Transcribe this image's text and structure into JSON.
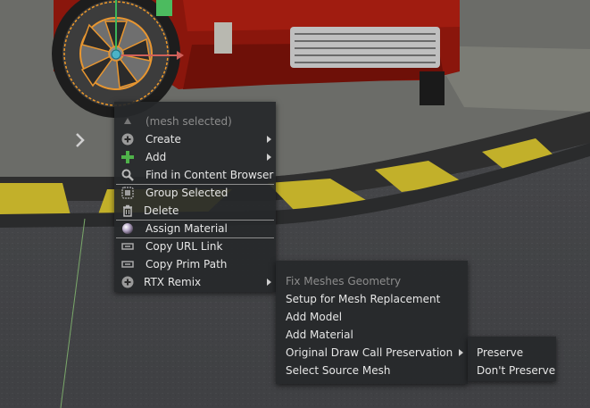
{
  "context_menu": {
    "header": "(mesh selected)",
    "items": [
      {
        "label": "Create",
        "icon": "plus-circle-icon"
      },
      {
        "label": "Add",
        "icon": "plus-icon"
      },
      {
        "label": "Find in Content Browser",
        "icon": "search-icon"
      },
      {
        "label": "Group Selected",
        "icon": "group-icon"
      },
      {
        "label": "Delete",
        "icon": "trash-icon"
      },
      {
        "label": "Assign Material",
        "icon": "material-sphere-icon"
      },
      {
        "label": "Copy URL Link",
        "icon": "link-icon"
      },
      {
        "label": "Copy Prim Path",
        "icon": "link-icon"
      },
      {
        "label": "RTX Remix",
        "icon": "plus-circle-icon"
      }
    ]
  },
  "rtx_submenu": {
    "items": [
      {
        "label": "Fix Meshes Geometry",
        "enabled": false
      },
      {
        "label": "Setup for Mesh Replacement"
      },
      {
        "label": "Add Model"
      },
      {
        "label": "Add Material"
      },
      {
        "label": "Original Draw Call Preservation"
      },
      {
        "label": "Select Source Mesh"
      }
    ]
  },
  "preservation_submenu": {
    "items": [
      {
        "label": "Preserve"
      },
      {
        "label": "Don't Preserve"
      }
    ]
  },
  "viewport": {
    "expand_icon": "chevron-right-icon"
  }
}
